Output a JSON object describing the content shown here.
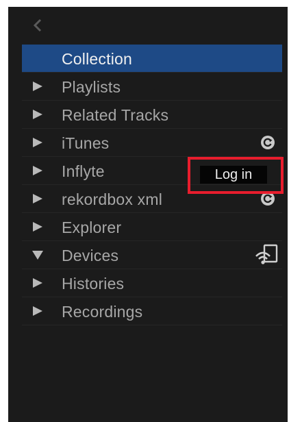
{
  "sidebar": {
    "back_icon": "chevron-left-icon",
    "items": [
      {
        "label": "Collection",
        "expanded": null,
        "selected": true
      },
      {
        "label": "Playlists",
        "expanded": false
      },
      {
        "label": "Related Tracks",
        "expanded": false
      },
      {
        "label": "iTunes",
        "expanded": false,
        "trailing_icon": "sync-icon"
      },
      {
        "label": "Inflyte",
        "expanded": false,
        "action_label": "Log in"
      },
      {
        "label": "rekordbox xml",
        "expanded": false,
        "trailing_icon": "sync-icon"
      },
      {
        "label": "Explorer",
        "expanded": false
      },
      {
        "label": "Devices",
        "expanded": true,
        "trailing_icon": "wifi-device-icon"
      },
      {
        "label": "Histories",
        "expanded": false
      },
      {
        "label": "Recordings",
        "expanded": false
      }
    ]
  },
  "colors": {
    "panel_background": "#1b1b1b",
    "selected_row": "#1e4a86",
    "highlight_border": "#e81d2d"
  }
}
